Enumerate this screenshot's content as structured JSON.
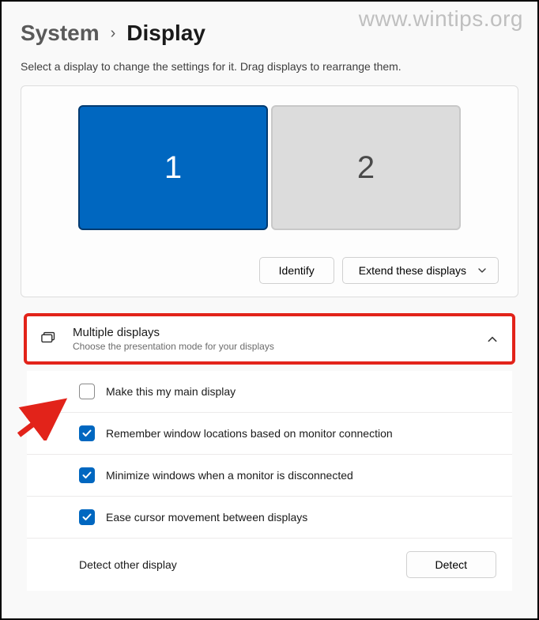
{
  "watermark": "www.wintips.org",
  "breadcrumb": {
    "parent": "System",
    "page": "Display"
  },
  "instruction": "Select a display to change the settings for it. Drag displays to rearrange them.",
  "monitors": {
    "one": "1",
    "two": "2"
  },
  "actions": {
    "identify": "Identify",
    "extend": "Extend these displays"
  },
  "panel": {
    "title": "Multiple displays",
    "subtitle": "Choose the presentation mode for your displays"
  },
  "options": {
    "main": "Make this my main display",
    "remember": "Remember window locations based on monitor connection",
    "minimize": "Minimize windows when a monitor is disconnected",
    "ease": "Ease cursor movement between displays",
    "detect_label": "Detect other display",
    "detect_button": "Detect"
  }
}
